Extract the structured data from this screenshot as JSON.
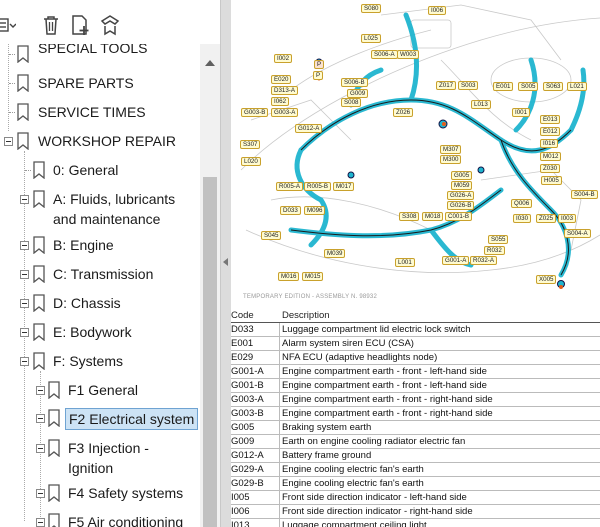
{
  "toolbar": {
    "icons": [
      "list-options-icon",
      "trash-icon",
      "add-bookmark-icon",
      "bookmark-properties-icon"
    ]
  },
  "bookmarks": [
    {
      "label": "SPECIAL TOOLS",
      "level": 0
    },
    {
      "label": "SPARE PARTS",
      "level": 0
    },
    {
      "label": "SERVICE TIMES",
      "level": 0
    },
    {
      "label": "WORKSHOP REPAIR",
      "level": 0,
      "expanded": true
    },
    {
      "label": "0: General",
      "level": 1
    },
    {
      "label": "A: Fluids, lubricants and maintenance",
      "level": 1
    },
    {
      "label": "B: Engine",
      "level": 1
    },
    {
      "label": "C: Transmission",
      "level": 1
    },
    {
      "label": "D: Chassis",
      "level": 1
    },
    {
      "label": "E: Bodywork",
      "level": 1
    },
    {
      "label": "F: Systems",
      "level": 1,
      "expanded": true
    },
    {
      "label": "F1 General",
      "level": 2
    },
    {
      "label": "F2 Electrical system",
      "level": 2,
      "selected": true
    },
    {
      "label": "F3 Injection - Ignition",
      "level": 2
    },
    {
      "label": "F4 Safety systems",
      "level": 2
    },
    {
      "label": "F5 Air conditioning",
      "level": 2
    }
  ],
  "diagram": {
    "harness_color": "#1fb5cf",
    "callout_fill": "#fffbd0",
    "callouts": [
      "S080",
      "I006",
      "L025",
      "W003",
      "I002",
      "S006-A",
      "E020",
      "P",
      "D313-A",
      "S006-B",
      "G009",
      "I062",
      "Z026",
      "G003-B",
      "G003-A",
      "G012-A",
      "Z017",
      "S003",
      "E001",
      "S005",
      "S063",
      "L021",
      "S307",
      "L020",
      "M307",
      "M300",
      "M012",
      "Z030",
      "R005-A",
      "R005-B",
      "M017",
      "G005",
      "M059",
      "G026-A",
      "G026-B",
      "Q006",
      "H005",
      "D033",
      "M096",
      "S308",
      "M018",
      "C001-B",
      "I030",
      "Z025",
      "I003",
      "S045",
      "S055",
      "R032",
      "M039",
      "G001-A",
      "R032-A",
      "S004-A",
      "L001",
      "M016",
      "M015",
      "X005",
      "E013",
      "E012",
      "I016",
      "S004-B",
      "L013",
      "S008",
      "I001",
      "P"
    ]
  },
  "watermark": "TEMPORARY EDITION - ASSEMBLY N. 98932",
  "legend": {
    "col_code": "Code",
    "col_desc": "Description",
    "rows": [
      {
        "code": "D033",
        "desc": "Luggage compartment lid electric lock switch"
      },
      {
        "code": "E001",
        "desc": "Alarm system siren ECU (CSA)"
      },
      {
        "code": "E029",
        "desc": "NFA ECU (adaptive headlights node)"
      },
      {
        "code": "G001-A",
        "desc": "Engine compartment earth - front - left-hand side"
      },
      {
        "code": "G001-B",
        "desc": "Engine compartment earth - front - left-hand side"
      },
      {
        "code": "G003-A",
        "desc": "Engine compartment earth - front - right-hand side"
      },
      {
        "code": "G003-B",
        "desc": "Engine compartment earth - front - right-hand side"
      },
      {
        "code": "G005",
        "desc": "Braking system earth"
      },
      {
        "code": "G009",
        "desc": "Earth on engine cooling radiator electric fan"
      },
      {
        "code": "G012-A",
        "desc": "Battery frame ground"
      },
      {
        "code": "G029-A",
        "desc": "Engine cooling electric fan's earth"
      },
      {
        "code": "G029-B",
        "desc": "Engine cooling electric fan's earth"
      },
      {
        "code": "I005",
        "desc": "Front side direction indicator - left-hand side"
      },
      {
        "code": "I006",
        "desc": "Front side direction indicator - right-hand side"
      },
      {
        "code": "I013",
        "desc": "Luggage compartment ceiling light"
      }
    ]
  }
}
